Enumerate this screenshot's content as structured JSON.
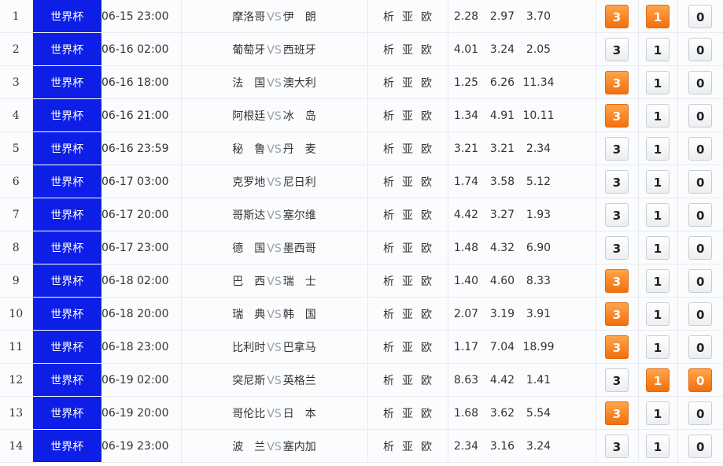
{
  "links": [
    "析",
    "亚",
    "欧"
  ],
  "vs_label": "VS",
  "rows": [
    {
      "num": "1",
      "league": "世界杯",
      "time": "06-15 23:00",
      "home": "摩洛哥",
      "away": "伊　朗",
      "odds": [
        "2.28",
        "2.97",
        "3.70"
      ],
      "picks": [
        {
          "label": "3",
          "on": true
        },
        {
          "label": "1",
          "on": true
        },
        {
          "label": "0",
          "on": false
        }
      ]
    },
    {
      "num": "2",
      "league": "世界杯",
      "time": "06-16 02:00",
      "home": "葡萄牙",
      "away": "西班牙",
      "odds": [
        "4.01",
        "3.24",
        "2.05"
      ],
      "picks": [
        {
          "label": "3",
          "on": false
        },
        {
          "label": "1",
          "on": false
        },
        {
          "label": "0",
          "on": false
        }
      ]
    },
    {
      "num": "3",
      "league": "世界杯",
      "time": "06-16 18:00",
      "home": "法　国",
      "away": "澳大利",
      "odds": [
        "1.25",
        "6.26",
        "11.34"
      ],
      "picks": [
        {
          "label": "3",
          "on": true
        },
        {
          "label": "1",
          "on": false
        },
        {
          "label": "0",
          "on": false
        }
      ]
    },
    {
      "num": "4",
      "league": "世界杯",
      "time": "06-16 21:00",
      "home": "阿根廷",
      "away": "冰　岛",
      "odds": [
        "1.34",
        "4.91",
        "10.11"
      ],
      "picks": [
        {
          "label": "3",
          "on": true
        },
        {
          "label": "1",
          "on": false
        },
        {
          "label": "0",
          "on": false
        }
      ]
    },
    {
      "num": "5",
      "league": "世界杯",
      "time": "06-16 23:59",
      "home": "秘　鲁",
      "away": "丹　麦",
      "odds": [
        "3.21",
        "3.21",
        "2.34"
      ],
      "picks": [
        {
          "label": "3",
          "on": false
        },
        {
          "label": "1",
          "on": false
        },
        {
          "label": "0",
          "on": false
        }
      ]
    },
    {
      "num": "6",
      "league": "世界杯",
      "time": "06-17 03:00",
      "home": "克罗地",
      "away": "尼日利",
      "odds": [
        "1.74",
        "3.58",
        "5.12"
      ],
      "picks": [
        {
          "label": "3",
          "on": false
        },
        {
          "label": "1",
          "on": false
        },
        {
          "label": "0",
          "on": false
        }
      ]
    },
    {
      "num": "7",
      "league": "世界杯",
      "time": "06-17 20:00",
      "home": "哥斯达",
      "away": "塞尔维",
      "odds": [
        "4.42",
        "3.27",
        "1.93"
      ],
      "picks": [
        {
          "label": "3",
          "on": false
        },
        {
          "label": "1",
          "on": false
        },
        {
          "label": "0",
          "on": false
        }
      ]
    },
    {
      "num": "8",
      "league": "世界杯",
      "time": "06-17 23:00",
      "home": "德　国",
      "away": "墨西哥",
      "odds": [
        "1.48",
        "4.32",
        "6.90"
      ],
      "picks": [
        {
          "label": "3",
          "on": false
        },
        {
          "label": "1",
          "on": false
        },
        {
          "label": "0",
          "on": false
        }
      ]
    },
    {
      "num": "9",
      "league": "世界杯",
      "time": "06-18 02:00",
      "home": "巴　西",
      "away": "瑞　士",
      "odds": [
        "1.40",
        "4.60",
        "8.33"
      ],
      "picks": [
        {
          "label": "3",
          "on": true
        },
        {
          "label": "1",
          "on": false
        },
        {
          "label": "0",
          "on": false
        }
      ]
    },
    {
      "num": "10",
      "league": "世界杯",
      "time": "06-18 20:00",
      "home": "瑞　典",
      "away": "韩　国",
      "odds": [
        "2.07",
        "3.19",
        "3.91"
      ],
      "picks": [
        {
          "label": "3",
          "on": true
        },
        {
          "label": "1",
          "on": false
        },
        {
          "label": "0",
          "on": false
        }
      ]
    },
    {
      "num": "11",
      "league": "世界杯",
      "time": "06-18 23:00",
      "home": "比利时",
      "away": "巴拿马",
      "odds": [
        "1.17",
        "7.04",
        "18.99"
      ],
      "picks": [
        {
          "label": "3",
          "on": true
        },
        {
          "label": "1",
          "on": false
        },
        {
          "label": "0",
          "on": false
        }
      ]
    },
    {
      "num": "12",
      "league": "世界杯",
      "time": "06-19 02:00",
      "home": "突尼斯",
      "away": "英格兰",
      "odds": [
        "8.63",
        "4.42",
        "1.41"
      ],
      "picks": [
        {
          "label": "3",
          "on": false
        },
        {
          "label": "1",
          "on": true
        },
        {
          "label": "0",
          "on": true
        }
      ]
    },
    {
      "num": "13",
      "league": "世界杯",
      "time": "06-19 20:00",
      "home": "哥伦比",
      "away": "日　本",
      "odds": [
        "1.68",
        "3.62",
        "5.54"
      ],
      "picks": [
        {
          "label": "3",
          "on": true
        },
        {
          "label": "1",
          "on": false
        },
        {
          "label": "0",
          "on": false
        }
      ]
    },
    {
      "num": "14",
      "league": "世界杯",
      "time": "06-19 23:00",
      "home": "波　兰",
      "away": "塞内加",
      "odds": [
        "2.34",
        "3.16",
        "3.24"
      ],
      "picks": [
        {
          "label": "3",
          "on": false
        },
        {
          "label": "1",
          "on": false
        },
        {
          "label": "0",
          "on": false
        }
      ]
    }
  ]
}
